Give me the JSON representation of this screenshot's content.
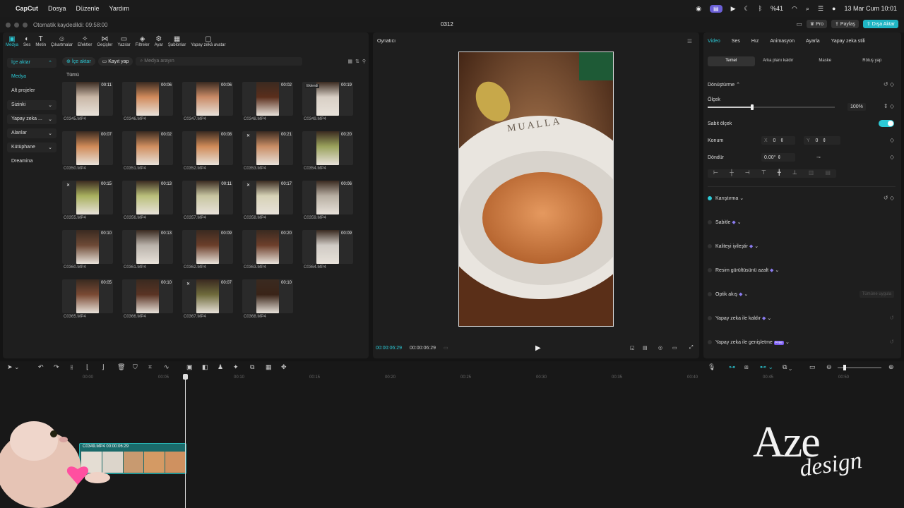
{
  "menubar": {
    "app": "CapCut",
    "items": [
      "Dosya",
      "Düzenle",
      "Yardım"
    ],
    "battery": "%41",
    "datetime": "13 Mar Cum 10:01"
  },
  "titlebar": {
    "autosave": "Otomatik kaydedildi: 09:58:00",
    "project": "0312",
    "pro": "Pro",
    "share": "Paylaş",
    "export": "Dışa Aktar"
  },
  "tools": [
    {
      "icon": "media-icon",
      "label": "Medya"
    },
    {
      "icon": "audio-icon",
      "label": "Ses"
    },
    {
      "icon": "text-icon",
      "label": "Metin"
    },
    {
      "icon": "sticker-icon",
      "label": "Çıkartmalar"
    },
    {
      "icon": "effects-icon",
      "label": "Efektler"
    },
    {
      "icon": "transitions-icon",
      "label": "Geçişler"
    },
    {
      "icon": "captions-icon",
      "label": "Yazılar"
    },
    {
      "icon": "filters-icon",
      "label": "Filtreler"
    },
    {
      "icon": "adjust-icon",
      "label": "Ayar"
    },
    {
      "icon": "templates-icon",
      "label": "Şablonlar"
    },
    {
      "icon": "ai-avatar-icon",
      "label": "Yapay zekâ avatar"
    }
  ],
  "sidenav": [
    {
      "label": "İçe aktar",
      "arrow": "⌃"
    },
    {
      "label": "Medya",
      "arrow": ""
    },
    {
      "label": "Alt projeler",
      "arrow": ""
    },
    {
      "label": "Sizinki",
      "arrow": "⌄"
    },
    {
      "label": "Yapay zeka ...",
      "arrow": "⌄"
    },
    {
      "label": "Alanlar",
      "arrow": "⌄"
    },
    {
      "label": "Kütüphane",
      "arrow": "⌄"
    },
    {
      "label": "Dreamina",
      "arrow": ""
    }
  ],
  "media_toolbar": {
    "import": "İçe aktar",
    "record": "Kayıt yap",
    "search_placeholder": "Medya arayın"
  },
  "all_label": "Tümü",
  "clips": [
    {
      "name": "C0345.MP4",
      "dur": "00:11",
      "c": "#c9b7a6",
      "mark": ""
    },
    {
      "name": "C0346.MP4",
      "dur": "00:06",
      "c": "#d18a5b",
      "mark": ""
    },
    {
      "name": "C0347.MP4",
      "dur": "00:06",
      "c": "#c98a66",
      "mark": ""
    },
    {
      "name": "C0348.MP4",
      "dur": "00:02",
      "c": "#5a2e1c",
      "mark": ""
    },
    {
      "name": "C0349.MP4",
      "dur": "00:19",
      "c": "#d8cfc5",
      "mark": "Eklendi"
    },
    {
      "name": "C0350.MP4",
      "dur": "00:07",
      "c": "#d08a58",
      "mark": ""
    },
    {
      "name": "C0351.MP4",
      "dur": "00:02",
      "c": "#d08e5f",
      "mark": ""
    },
    {
      "name": "C0352.MP4",
      "dur": "00:08",
      "c": "#cf8a58",
      "mark": ""
    },
    {
      "name": "C0353.MP4",
      "dur": "00:21",
      "c": "#c98d65",
      "mark": "✕"
    },
    {
      "name": "C0354.MP4",
      "dur": "00:20",
      "c": "#9aa25c",
      "mark": ""
    },
    {
      "name": "C0355.MP4",
      "dur": "00:15",
      "c": "#a8b05e",
      "mark": "✕"
    },
    {
      "name": "C0356.MP4",
      "dur": "00:13",
      "c": "#b9bf7a",
      "mark": ""
    },
    {
      "name": "C0357.MP4",
      "dur": "00:11",
      "c": "#c7c5a0",
      "mark": ""
    },
    {
      "name": "C0358.MP4",
      "dur": "00:17",
      "c": "#d6d2b6",
      "mark": "✕"
    },
    {
      "name": "C0359.MP4",
      "dur": "00:06",
      "c": "#b7aea2",
      "mark": ""
    },
    {
      "name": "C0360.MP4",
      "dur": "00:10",
      "c": "#6e4a36",
      "mark": ""
    },
    {
      "name": "C0361.MP4",
      "dur": "00:13",
      "c": "#b9b2aa",
      "mark": ""
    },
    {
      "name": "C0362.MP4",
      "dur": "00:09",
      "c": "#6b3e2a",
      "mark": ""
    },
    {
      "name": "C0363.MP4",
      "dur": "00:20",
      "c": "#6d3f2b",
      "mark": ""
    },
    {
      "name": "C0364.MP4",
      "dur": "00:09",
      "c": "#cfcac4",
      "mark": ""
    },
    {
      "name": "C0365.MP4",
      "dur": "00:05",
      "c": "#7a4a34",
      "mark": ""
    },
    {
      "name": "C0366.MP4",
      "dur": "00:10",
      "c": "#5a3424",
      "mark": ""
    },
    {
      "name": "C0367.MP4",
      "dur": "00:07",
      "c": "#6f6b3c",
      "mark": "✕"
    },
    {
      "name": "C0368.MP4",
      "dur": "00:10",
      "c": "#3a2418",
      "mark": ""
    }
  ],
  "player": {
    "title": "Oynatıcı",
    "current": "00:00:06:29",
    "total": "00:00:06:29",
    "brand_text": "MUALLA"
  },
  "inspector": {
    "tabs": [
      "Video",
      "Ses",
      "Hız",
      "Animasyon",
      "Ayarla",
      "Yapay zeka stili"
    ],
    "subtabs": [
      "Temel",
      "Arka planı kaldır",
      "Maske",
      "Rötuş yap"
    ],
    "transform": "Dönüştürme",
    "scale": "Ölçek",
    "scale_val": "100%",
    "scale_level": 0.35,
    "uniform": "Sabit ölçek",
    "position": "Konum",
    "pos_x_label": "X",
    "pos_x": "0",
    "pos_y_label": "Y",
    "pos_y": "0",
    "rotate": "Döndür",
    "rotate_val": "0.00°",
    "blend": "Karıştırma",
    "stabilize": "Sabitle",
    "enhance": "Kaliteyi iyileştir",
    "denoise": "Resim gürültüsünü azalt",
    "optical": "Optik akış",
    "optical_hint": "Tümüne uygula",
    "ai_remove": "Yapay zeka ile kaldır",
    "ai_expand": "Yapay zeka ile genişletme",
    "free_badge": "Free"
  },
  "timeline": {
    "ticks": [
      "00:00",
      "00:05",
      "00:10",
      "00:15",
      "00:20",
      "00:25",
      "00:30",
      "00:35",
      "00:40",
      "00:45",
      "00:50"
    ],
    "clip_label": "C0349.MP4  00:00:06:29"
  },
  "watermark": {
    "main": "Aze",
    "script": "design"
  },
  "colors": {
    "accent": "#2cc9d6",
    "purple": "#6b5fd6",
    "clip": "#1a6a6a"
  }
}
